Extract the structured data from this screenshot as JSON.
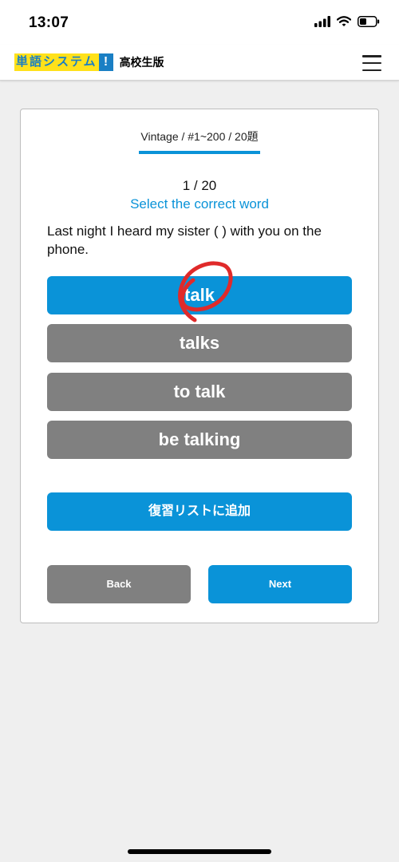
{
  "status_bar": {
    "time": "13:07",
    "icons": [
      "signal-icon",
      "wifi-icon",
      "battery-icon"
    ]
  },
  "header": {
    "logo_text": "単語システム",
    "logo_bang": "!",
    "logo_sub": "高校生版",
    "menu_icon": "hamburger-menu-icon"
  },
  "quiz": {
    "breadcrumb": "Vintage / #1~200 / 20題",
    "progress": "1 / 20",
    "instruction": "Select the correct word",
    "question": "Last night I heard my sister ( ) with you on the phone.",
    "options": [
      {
        "label": "talk",
        "selected": true
      },
      {
        "label": "talks",
        "selected": false
      },
      {
        "label": "to talk",
        "selected": false
      },
      {
        "label": "be talking",
        "selected": false
      }
    ],
    "review_button": "復習リストに追加",
    "back_button": "Back",
    "next_button": "Next"
  },
  "colors": {
    "accent": "#0a93d8",
    "option_default": "#808080",
    "logo_yellow": "#ffe11a",
    "annotation_red": "#e02a2a"
  }
}
